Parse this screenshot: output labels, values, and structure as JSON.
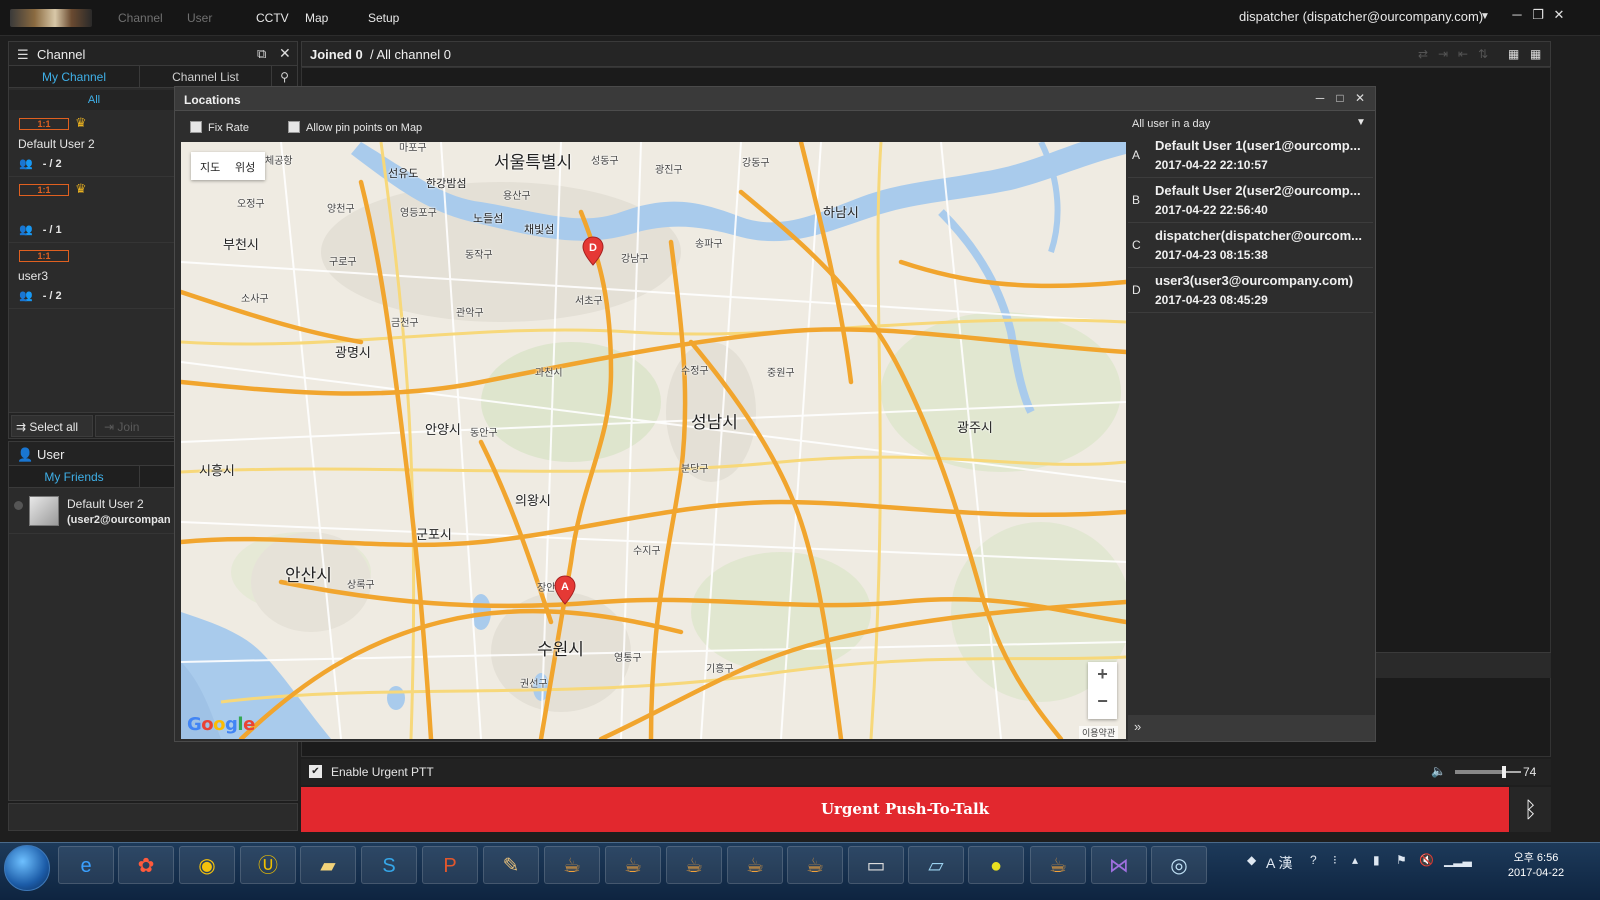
{
  "menu": {
    "items": [
      {
        "label": "Channel",
        "dim": true
      },
      {
        "label": "User",
        "dim": true
      },
      {
        "label": "CCTV",
        "dim": false
      },
      {
        "label": "Map",
        "dim": false
      },
      {
        "label": "Setup",
        "dim": false
      }
    ],
    "account": "dispatcher (dispatcher@ourcompany.com)"
  },
  "channel_panel": {
    "title": "Channel",
    "tabs": [
      "My Channel",
      "Channel List"
    ],
    "filter": "All",
    "items": [
      {
        "badge": "1:1",
        "crown": true,
        "name": "Default User 2",
        "count": "- / 2"
      },
      {
        "badge": "1:1",
        "crown": true,
        "name": "",
        "count": "- / 1"
      },
      {
        "badge": "1:1",
        "crown": false,
        "name": "user3",
        "count": "- / 2"
      }
    ],
    "select_all": "Select all",
    "join": "Join"
  },
  "user_panel": {
    "title": "User",
    "tab": "My Friends",
    "friends": [
      {
        "name": "Default User 2",
        "email": "(user2@ourcompan"
      }
    ]
  },
  "main": {
    "joined_label": "Joined 0",
    "all_label": "/ All channel 0",
    "urgent_label": "Enable Urgent PTT",
    "volume": 74,
    "ptt_label": "Urgent Push-To-Talk"
  },
  "locations": {
    "title": "Locations",
    "fix_rate": "Fix Rate",
    "allow_pin": "Allow pin points on Map",
    "filter": "All user in a day",
    "map_type": [
      "지도",
      "위성"
    ],
    "zoom_in": "+",
    "zoom_out": "−",
    "terms": "이용약관",
    "google": "Google",
    "users": [
      {
        "letter": "A",
        "name": "Default User 1(user1@ourcomp...",
        "time": "2017-04-22 22:10:57"
      },
      {
        "letter": "B",
        "name": "Default User 2(user2@ourcomp...",
        "time": "2017-04-22 22:56:40"
      },
      {
        "letter": "C",
        "name": "dispatcher(dispatcher@ourcom...",
        "time": "2017-04-23 08:15:38"
      },
      {
        "letter": "D",
        "name": "user3(user3@ourcompany.com)",
        "time": "2017-04-23 08:45:29"
      }
    ],
    "map_labels": [
      {
        "text": "서울특별시",
        "size": "big"
      },
      {
        "text": "부천시",
        "size": "mid"
      },
      {
        "text": "광명시",
        "size": "mid"
      },
      {
        "text": "하남시",
        "size": "mid"
      },
      {
        "text": "성남시",
        "size": "big"
      },
      {
        "text": "광주시",
        "size": "mid"
      },
      {
        "text": "안양시",
        "size": "mid"
      },
      {
        "text": "시흥시",
        "size": "mid"
      },
      {
        "text": "의왕시",
        "size": "mid"
      },
      {
        "text": "군포시",
        "size": "mid"
      },
      {
        "text": "안산시",
        "size": "big"
      },
      {
        "text": "수원시",
        "size": "big"
      },
      {
        "text": "강남구",
        "size": "sm"
      },
      {
        "text": "서초구",
        "size": "sm"
      },
      {
        "text": "송파구",
        "size": "sm"
      },
      {
        "text": "관악구",
        "size": "sm"
      },
      {
        "text": "과천시",
        "size": "sm"
      },
      {
        "text": "수정구",
        "size": "sm"
      },
      {
        "text": "중원구",
        "size": "sm"
      },
      {
        "text": "분당구",
        "size": "sm"
      },
      {
        "text": "수지구",
        "size": "sm"
      },
      {
        "text": "기흥구",
        "size": "sm"
      },
      {
        "text": "영통구",
        "size": "sm"
      },
      {
        "text": "권선구",
        "size": "sm"
      },
      {
        "text": "상록구",
        "size": "sm"
      },
      {
        "text": "동안구",
        "size": "sm"
      },
      {
        "text": "금천구",
        "size": "sm"
      },
      {
        "text": "구로구",
        "size": "sm"
      },
      {
        "text": "양천구",
        "size": "sm"
      },
      {
        "text": "영등포구",
        "size": "sm"
      },
      {
        "text": "동작구",
        "size": "sm"
      },
      {
        "text": "용산구",
        "size": "sm"
      },
      {
        "text": "마포구",
        "size": "sm"
      },
      {
        "text": "광진구",
        "size": "sm"
      },
      {
        "text": "강동구",
        "size": "sm"
      },
      {
        "text": "성동구",
        "size": "sm"
      },
      {
        "text": "한강밤섬",
        "size": "sm"
      },
      {
        "text": "선유도",
        "size": "sm"
      },
      {
        "text": "노들섬",
        "size": "sm"
      },
      {
        "text": "채빛섬",
        "size": "sm"
      },
      {
        "text": "오정구",
        "size": "sm"
      },
      {
        "text": "소사구",
        "size": "sm"
      },
      {
        "text": "체공항",
        "size": "sm"
      },
      {
        "text": "장안",
        "size": "sm"
      }
    ],
    "pins": [
      "D",
      "A"
    ]
  },
  "taskbar": {
    "time": "오후 6:56",
    "date": "2017-04-22",
    "ime": "A 漢"
  },
  "colors": {
    "accent": "#3fb0e8",
    "urgent": "#e2282e",
    "pin": "#e53935",
    "badge": "#e06020"
  }
}
